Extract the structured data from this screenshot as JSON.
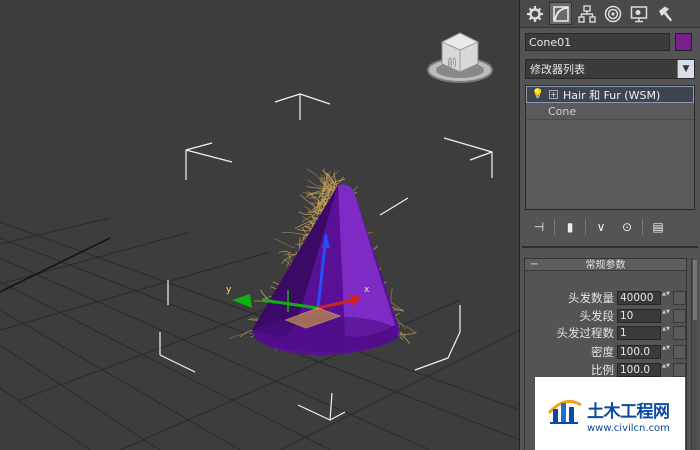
{
  "viewport": {
    "viewcube_label": "前",
    "axis_x": "x",
    "axis_y": "y",
    "object_color": "#6a1aa8",
    "hair_color": "#c9a45a"
  },
  "panel": {
    "tabs": [
      {
        "name": "create",
        "icon": "gear-icon"
      },
      {
        "name": "modify",
        "icon": "modify-curve-icon",
        "active": true
      },
      {
        "name": "hierarchy",
        "icon": "hierarchy-icon"
      },
      {
        "name": "motion",
        "icon": "motion-icon"
      },
      {
        "name": "display",
        "icon": "display-monitor-icon"
      },
      {
        "name": "utilities",
        "icon": "hammer-icon"
      }
    ],
    "object_name": "Cone01",
    "object_color": "#7a1e8c",
    "modifier_list_label": "修改器列表",
    "stack": {
      "modifier": "Hair 和 Fur (WSM)",
      "base": "Cone"
    },
    "rollout": {
      "title": "常规参数",
      "params": [
        {
          "label": "头发数量",
          "value": "40000"
        },
        {
          "label": "头发段",
          "value": "10"
        },
        {
          "label": "头发过程数",
          "value": "1"
        },
        {
          "label": "密度",
          "value": "100.0"
        },
        {
          "label": "比例",
          "value": "100.0"
        }
      ]
    }
  },
  "watermark": {
    "title": "土木工程网",
    "url": "www.civilcn.com"
  }
}
